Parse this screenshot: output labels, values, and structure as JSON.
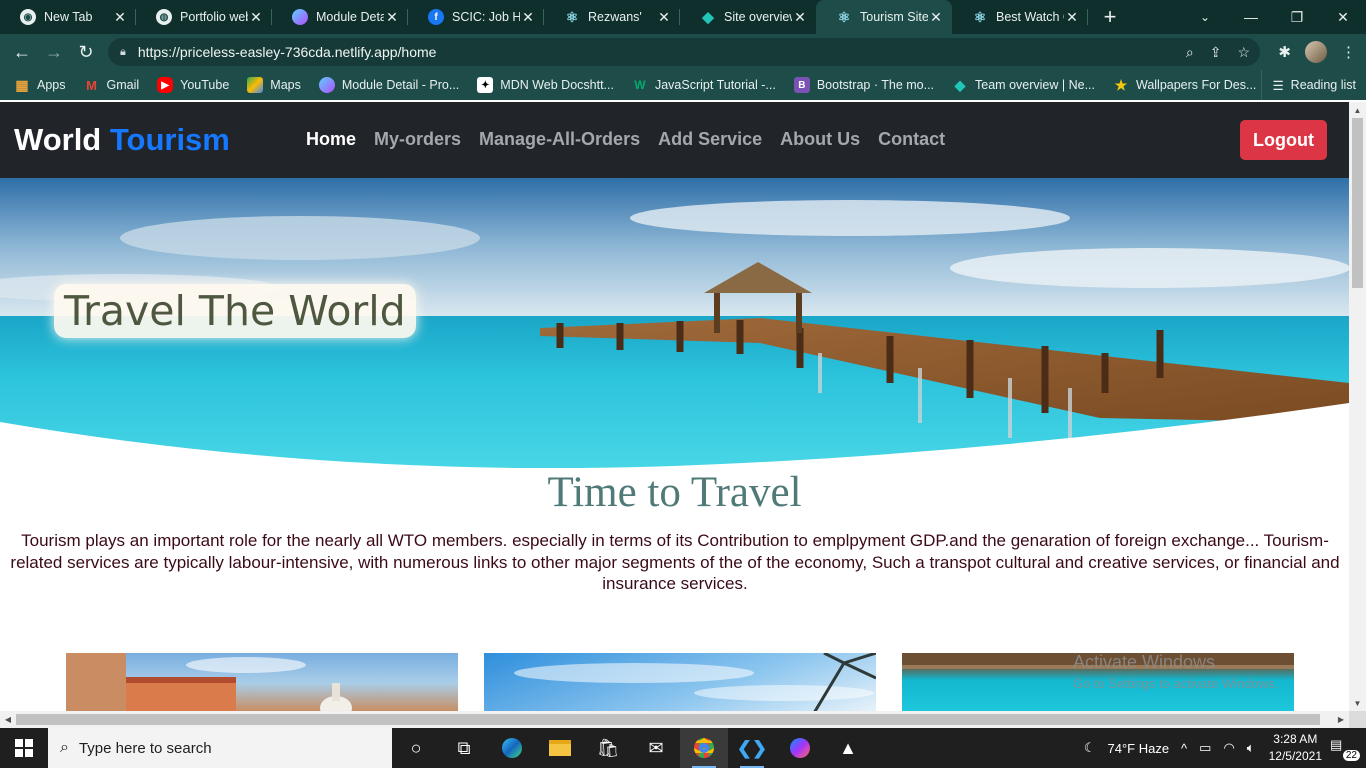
{
  "browser": {
    "tabs": [
      {
        "title": "New Tab",
        "favicon": "chrome-icon",
        "color": "#5b7d7b",
        "active": false
      },
      {
        "title": "Portfolio web",
        "favicon": "globe-icon",
        "color": "#5b7d7b",
        "active": false
      },
      {
        "title": "Module Detai",
        "favicon": "module-icon",
        "color": "#7c4dff",
        "active": false
      },
      {
        "title": "SCIC: Job Hur",
        "favicon": "facebook-icon",
        "color": "#1877f2",
        "active": false
      },
      {
        "title": "Rezwans'",
        "favicon": "react-icon",
        "color": "#61dafb",
        "active": false
      },
      {
        "title": "Site overview",
        "favicon": "netlify-icon",
        "color": "#20c6b7",
        "active": false
      },
      {
        "title": "Tourism Site",
        "favicon": "react-icon",
        "color": "#61dafb",
        "active": true
      },
      {
        "title": "Best Watch Co",
        "favicon": "react-icon",
        "color": "#61dafb",
        "active": false
      }
    ],
    "url": "https://priceless-easley-736cda.netlify.app/home",
    "bookmarks": [
      {
        "label": "Apps",
        "icon": "apps-grid-icon",
        "color": "#e8a33d"
      },
      {
        "label": "Gmail",
        "icon": "gmail-icon",
        "color": "#ea4335"
      },
      {
        "label": "YouTube",
        "icon": "youtube-icon",
        "color": "#ff0000"
      },
      {
        "label": "Maps",
        "icon": "maps-icon",
        "color": "#34a853"
      },
      {
        "label": "Module Detail - Pro...",
        "icon": "module-icon",
        "color": "#7c4dff"
      },
      {
        "label": "MDN Web Docshtt...",
        "icon": "mdn-icon",
        "color": "#000000"
      },
      {
        "label": "JavaScript Tutorial -...",
        "icon": "w3-icon",
        "color": "#04aa6d"
      },
      {
        "label": "Bootstrap · The mo...",
        "icon": "bootstrap-icon",
        "color": "#7952b3"
      },
      {
        "label": "Team overview | Ne...",
        "icon": "netlify-icon",
        "color": "#20c6b7"
      },
      {
        "label": "Wallpapers For Des...",
        "icon": "star-icon",
        "color": "#f2c811"
      }
    ],
    "reading_list": "Reading list"
  },
  "site": {
    "brand_main": "World",
    "brand_accent": "Tourism",
    "nav": [
      "Home",
      "My-orders",
      "Manage-All-Orders",
      "Add Service",
      "About Us",
      "Contact"
    ],
    "logout": "Logout",
    "hero_title": "Travel The World",
    "section_title": "Time to Travel",
    "section_text": "Tourism plays an important role for the nearly all WTO members. especially in terms of its Contribution to emplpyment GDP.and the genaration of foreign exchange... Tourism-related services are typically labour-intensive, with numerous links to other major segments of the of the economy, Such a transpot cultural and creative services, or financial and insurance services.",
    "brand_color": "#1677ff",
    "logout_color": "#dc3545"
  },
  "watermark": {
    "line1": "Activate Windows",
    "line2": "Go to Settings to activate Windows."
  },
  "taskbar": {
    "search_placeholder": "Type here to search",
    "weather": "74°F  Haze",
    "time": "3:28 AM",
    "date": "12/5/2021",
    "notifications": "22"
  }
}
